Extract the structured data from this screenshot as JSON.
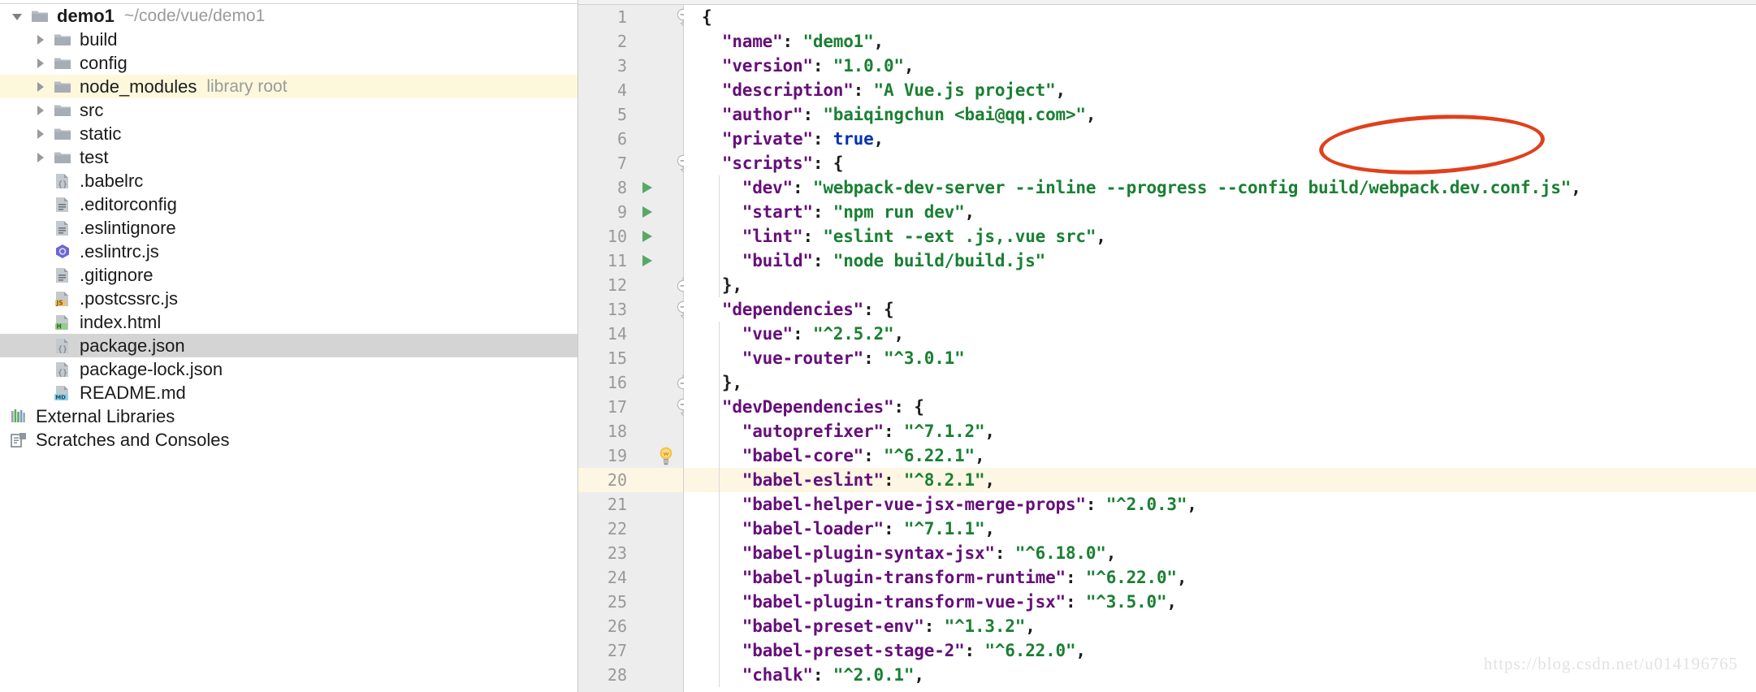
{
  "project_pane": {
    "root": {
      "label": "demo1",
      "path": "~/code/vue/demo1",
      "icon": "folder-icon",
      "expanded": true
    },
    "items": [
      {
        "label": "build",
        "icon": "folder-icon",
        "kind": "folder",
        "indent": 1,
        "twisty": "collapsed",
        "badge": "",
        "state": ""
      },
      {
        "label": "config",
        "icon": "folder-icon",
        "kind": "folder",
        "indent": 1,
        "twisty": "collapsed",
        "badge": "",
        "state": ""
      },
      {
        "label": "node_modules",
        "icon": "folder-icon",
        "kind": "folder",
        "indent": 1,
        "twisty": "collapsed",
        "badge": "library root",
        "state": "highlight"
      },
      {
        "label": "src",
        "icon": "folder-icon",
        "kind": "folder",
        "indent": 1,
        "twisty": "collapsed",
        "badge": "",
        "state": ""
      },
      {
        "label": "static",
        "icon": "folder-icon",
        "kind": "folder",
        "indent": 1,
        "twisty": "collapsed",
        "badge": "",
        "state": ""
      },
      {
        "label": "test",
        "icon": "folder-icon",
        "kind": "folder",
        "indent": 1,
        "twisty": "collapsed",
        "badge": "",
        "state": ""
      },
      {
        "label": ".babelrc",
        "icon": "json-file-icon",
        "kind": "file",
        "indent": 1,
        "twisty": "none",
        "badge": "",
        "state": ""
      },
      {
        "label": ".editorconfig",
        "icon": "text-file-icon",
        "kind": "file",
        "indent": 1,
        "twisty": "none",
        "badge": "",
        "state": ""
      },
      {
        "label": ".eslintignore",
        "icon": "text-file-icon",
        "kind": "file",
        "indent": 1,
        "twisty": "none",
        "badge": "",
        "state": ""
      },
      {
        "label": ".eslintrc.js",
        "icon": "eslint-icon",
        "kind": "file",
        "indent": 1,
        "twisty": "none",
        "badge": "",
        "state": ""
      },
      {
        "label": ".gitignore",
        "icon": "text-file-icon",
        "kind": "file",
        "indent": 1,
        "twisty": "none",
        "badge": "",
        "state": ""
      },
      {
        "label": ".postcssrc.js",
        "icon": "js-file-icon",
        "kind": "file",
        "indent": 1,
        "twisty": "none",
        "badge": "",
        "state": ""
      },
      {
        "label": "index.html",
        "icon": "html-file-icon",
        "kind": "file",
        "indent": 1,
        "twisty": "none",
        "badge": "",
        "state": ""
      },
      {
        "label": "package.json",
        "icon": "json-file-icon",
        "kind": "file",
        "indent": 1,
        "twisty": "none",
        "badge": "",
        "state": "selected"
      },
      {
        "label": "package-lock.json",
        "icon": "json-file-icon",
        "kind": "file",
        "indent": 1,
        "twisty": "none",
        "badge": "",
        "state": ""
      },
      {
        "label": "README.md",
        "icon": "md-file-icon",
        "kind": "file",
        "indent": 1,
        "twisty": "none",
        "badge": "",
        "state": ""
      },
      {
        "label": "External Libraries",
        "icon": "libraries-icon",
        "kind": "node",
        "indent": 0,
        "twisty": "none",
        "badge": "",
        "state": ""
      },
      {
        "label": "Scratches and Consoles",
        "icon": "scratches-icon",
        "kind": "node",
        "indent": 0,
        "twisty": "none",
        "badge": "",
        "state": ""
      }
    ]
  },
  "editor": {
    "language": "json",
    "current_line": 20,
    "lines": [
      {
        "n": 1,
        "fold": "open",
        "run": false,
        "bulb": false,
        "hl": false,
        "tokens": [
          {
            "t": "{",
            "c": "p"
          }
        ]
      },
      {
        "n": 2,
        "fold": "",
        "run": false,
        "bulb": false,
        "hl": false,
        "tokens": [
          {
            "t": "  \"name\"",
            "c": "k"
          },
          {
            "t": ": ",
            "c": "p"
          },
          {
            "t": "\"demo1\"",
            "c": "s"
          },
          {
            "t": ",",
            "c": "p"
          }
        ]
      },
      {
        "n": 3,
        "fold": "",
        "run": false,
        "bulb": false,
        "hl": false,
        "tokens": [
          {
            "t": "  \"version\"",
            "c": "k"
          },
          {
            "t": ": ",
            "c": "p"
          },
          {
            "t": "\"1.0.0\"",
            "c": "s"
          },
          {
            "t": ",",
            "c": "p"
          }
        ]
      },
      {
        "n": 4,
        "fold": "",
        "run": false,
        "bulb": false,
        "hl": false,
        "tokens": [
          {
            "t": "  \"description\"",
            "c": "k"
          },
          {
            "t": ": ",
            "c": "p"
          },
          {
            "t": "\"A Vue.js project\"",
            "c": "s"
          },
          {
            "t": ",",
            "c": "p"
          }
        ]
      },
      {
        "n": 5,
        "fold": "",
        "run": false,
        "bulb": false,
        "hl": false,
        "tokens": [
          {
            "t": "  \"author\"",
            "c": "k"
          },
          {
            "t": ": ",
            "c": "p"
          },
          {
            "t": "\"baiqingchun <bai@qq.com>\"",
            "c": "s"
          },
          {
            "t": ",",
            "c": "p"
          }
        ]
      },
      {
        "n": 6,
        "fold": "",
        "run": false,
        "bulb": false,
        "hl": false,
        "tokens": [
          {
            "t": "  \"private\"",
            "c": "k"
          },
          {
            "t": ": ",
            "c": "p"
          },
          {
            "t": "true",
            "c": "b"
          },
          {
            "t": ",",
            "c": "p"
          }
        ]
      },
      {
        "n": 7,
        "fold": "open",
        "run": false,
        "bulb": false,
        "hl": false,
        "tokens": [
          {
            "t": "  \"scripts\"",
            "c": "k"
          },
          {
            "t": ": {",
            "c": "p"
          }
        ]
      },
      {
        "n": 8,
        "fold": "",
        "run": true,
        "bulb": false,
        "hl": false,
        "tokens": [
          {
            "t": "    \"dev\"",
            "c": "k"
          },
          {
            "t": ": ",
            "c": "p"
          },
          {
            "t": "\"webpack-dev-server --inline --progress --config build/webpack.dev.conf.js\"",
            "c": "s"
          },
          {
            "t": ",",
            "c": "p"
          }
        ]
      },
      {
        "n": 9,
        "fold": "",
        "run": true,
        "bulb": false,
        "hl": false,
        "tokens": [
          {
            "t": "    \"start\"",
            "c": "k"
          },
          {
            "t": ": ",
            "c": "p"
          },
          {
            "t": "\"npm run dev\"",
            "c": "s"
          },
          {
            "t": ",",
            "c": "p"
          }
        ]
      },
      {
        "n": 10,
        "fold": "",
        "run": true,
        "bulb": false,
        "hl": false,
        "tokens": [
          {
            "t": "    \"lint\"",
            "c": "k"
          },
          {
            "t": ": ",
            "c": "p"
          },
          {
            "t": "\"eslint --ext .js,.vue src\"",
            "c": "s"
          },
          {
            "t": ",",
            "c": "p"
          }
        ]
      },
      {
        "n": 11,
        "fold": "",
        "run": true,
        "bulb": false,
        "hl": false,
        "tokens": [
          {
            "t": "    \"build\"",
            "c": "k"
          },
          {
            "t": ": ",
            "c": "p"
          },
          {
            "t": "\"node build/build.js\"",
            "c": "s"
          }
        ]
      },
      {
        "n": 12,
        "fold": "close",
        "run": false,
        "bulb": false,
        "hl": false,
        "tokens": [
          {
            "t": "  },",
            "c": "p"
          }
        ]
      },
      {
        "n": 13,
        "fold": "open",
        "run": false,
        "bulb": false,
        "hl": false,
        "tokens": [
          {
            "t": "  \"dependencies\"",
            "c": "k"
          },
          {
            "t": ": {",
            "c": "p"
          }
        ]
      },
      {
        "n": 14,
        "fold": "",
        "run": false,
        "bulb": false,
        "hl": false,
        "tokens": [
          {
            "t": "    \"vue\"",
            "c": "k"
          },
          {
            "t": ": ",
            "c": "p"
          },
          {
            "t": "\"^2.5.2\"",
            "c": "s"
          },
          {
            "t": ",",
            "c": "p"
          }
        ]
      },
      {
        "n": 15,
        "fold": "",
        "run": false,
        "bulb": false,
        "hl": false,
        "tokens": [
          {
            "t": "    \"vue-router\"",
            "c": "k"
          },
          {
            "t": ": ",
            "c": "p"
          },
          {
            "t": "\"^3.0.1\"",
            "c": "s"
          }
        ]
      },
      {
        "n": 16,
        "fold": "close",
        "run": false,
        "bulb": false,
        "hl": false,
        "tokens": [
          {
            "t": "  },",
            "c": "p"
          }
        ]
      },
      {
        "n": 17,
        "fold": "open",
        "run": false,
        "bulb": false,
        "hl": false,
        "tokens": [
          {
            "t": "  \"devDependencies\"",
            "c": "k"
          },
          {
            "t": ": {",
            "c": "p"
          }
        ]
      },
      {
        "n": 18,
        "fold": "",
        "run": false,
        "bulb": false,
        "hl": false,
        "tokens": [
          {
            "t": "    \"autoprefixer\"",
            "c": "k"
          },
          {
            "t": ": ",
            "c": "p"
          },
          {
            "t": "\"^7.1.2\"",
            "c": "s"
          },
          {
            "t": ",",
            "c": "p"
          }
        ]
      },
      {
        "n": 19,
        "fold": "",
        "run": false,
        "bulb": true,
        "hl": false,
        "tokens": [
          {
            "t": "    \"babel-core\"",
            "c": "k"
          },
          {
            "t": ": ",
            "c": "p"
          },
          {
            "t": "\"^6.22.1\"",
            "c": "s"
          },
          {
            "t": ",",
            "c": "p"
          }
        ]
      },
      {
        "n": 20,
        "fold": "",
        "run": false,
        "bulb": false,
        "hl": true,
        "tokens": [
          {
            "t": "    \"babel-eslint\"",
            "c": "k"
          },
          {
            "t": ": ",
            "c": "p"
          },
          {
            "t": "\"^8.2.1\"",
            "c": "s"
          },
          {
            "t": ",",
            "c": "p"
          }
        ]
      },
      {
        "n": 21,
        "fold": "",
        "run": false,
        "bulb": false,
        "hl": false,
        "tokens": [
          {
            "t": "    \"babel-helper-vue-jsx-merge-props\"",
            "c": "k"
          },
          {
            "t": ": ",
            "c": "p"
          },
          {
            "t": "\"^2.0.3\"",
            "c": "s"
          },
          {
            "t": ",",
            "c": "p"
          }
        ]
      },
      {
        "n": 22,
        "fold": "",
        "run": false,
        "bulb": false,
        "hl": false,
        "tokens": [
          {
            "t": "    \"babel-loader\"",
            "c": "k"
          },
          {
            "t": ": ",
            "c": "p"
          },
          {
            "t": "\"^7.1.1\"",
            "c": "s"
          },
          {
            "t": ",",
            "c": "p"
          }
        ]
      },
      {
        "n": 23,
        "fold": "",
        "run": false,
        "bulb": false,
        "hl": false,
        "tokens": [
          {
            "t": "    \"babel-plugin-syntax-jsx\"",
            "c": "k"
          },
          {
            "t": ": ",
            "c": "p"
          },
          {
            "t": "\"^6.18.0\"",
            "c": "s"
          },
          {
            "t": ",",
            "c": "p"
          }
        ]
      },
      {
        "n": 24,
        "fold": "",
        "run": false,
        "bulb": false,
        "hl": false,
        "tokens": [
          {
            "t": "    \"babel-plugin-transform-runtime\"",
            "c": "k"
          },
          {
            "t": ": ",
            "c": "p"
          },
          {
            "t": "\"^6.22.0\"",
            "c": "s"
          },
          {
            "t": ",",
            "c": "p"
          }
        ]
      },
      {
        "n": 25,
        "fold": "",
        "run": false,
        "bulb": false,
        "hl": false,
        "tokens": [
          {
            "t": "    \"babel-plugin-transform-vue-jsx\"",
            "c": "k"
          },
          {
            "t": ": ",
            "c": "p"
          },
          {
            "t": "\"^3.5.0\"",
            "c": "s"
          },
          {
            "t": ",",
            "c": "p"
          }
        ]
      },
      {
        "n": 26,
        "fold": "",
        "run": false,
        "bulb": false,
        "hl": false,
        "tokens": [
          {
            "t": "    \"babel-preset-env\"",
            "c": "k"
          },
          {
            "t": ": ",
            "c": "p"
          },
          {
            "t": "\"^1.3.2\"",
            "c": "s"
          },
          {
            "t": ",",
            "c": "p"
          }
        ]
      },
      {
        "n": 27,
        "fold": "",
        "run": false,
        "bulb": false,
        "hl": false,
        "tokens": [
          {
            "t": "    \"babel-preset-stage-2\"",
            "c": "k"
          },
          {
            "t": ": ",
            "c": "p"
          },
          {
            "t": "\"^6.22.0\"",
            "c": "s"
          },
          {
            "t": ",",
            "c": "p"
          }
        ]
      },
      {
        "n": 28,
        "fold": "",
        "run": false,
        "bulb": false,
        "hl": false,
        "tokens": [
          {
            "t": "    \"chalk\"",
            "c": "k"
          },
          {
            "t": ": ",
            "c": "p"
          },
          {
            "t": "\"^2.0.1\"",
            "c": "s"
          },
          {
            "t": ",",
            "c": "p"
          }
        ]
      }
    ]
  },
  "annotation": {
    "shape": "ellipse",
    "color": "#e0401b",
    "targets": "dev script line"
  },
  "watermark": {
    "text": "https://blog.csdn.net/u014196765"
  },
  "colors": {
    "key": "#660e7a",
    "string": "#1a8033",
    "keyword": "#0033b3",
    "gutter_bg": "#ededed",
    "current_line_bg": "#fcf6e3",
    "selection_bg": "#d4d4d4",
    "library_root_bg": "#fdf8dc",
    "annotation": "#e0401b"
  }
}
